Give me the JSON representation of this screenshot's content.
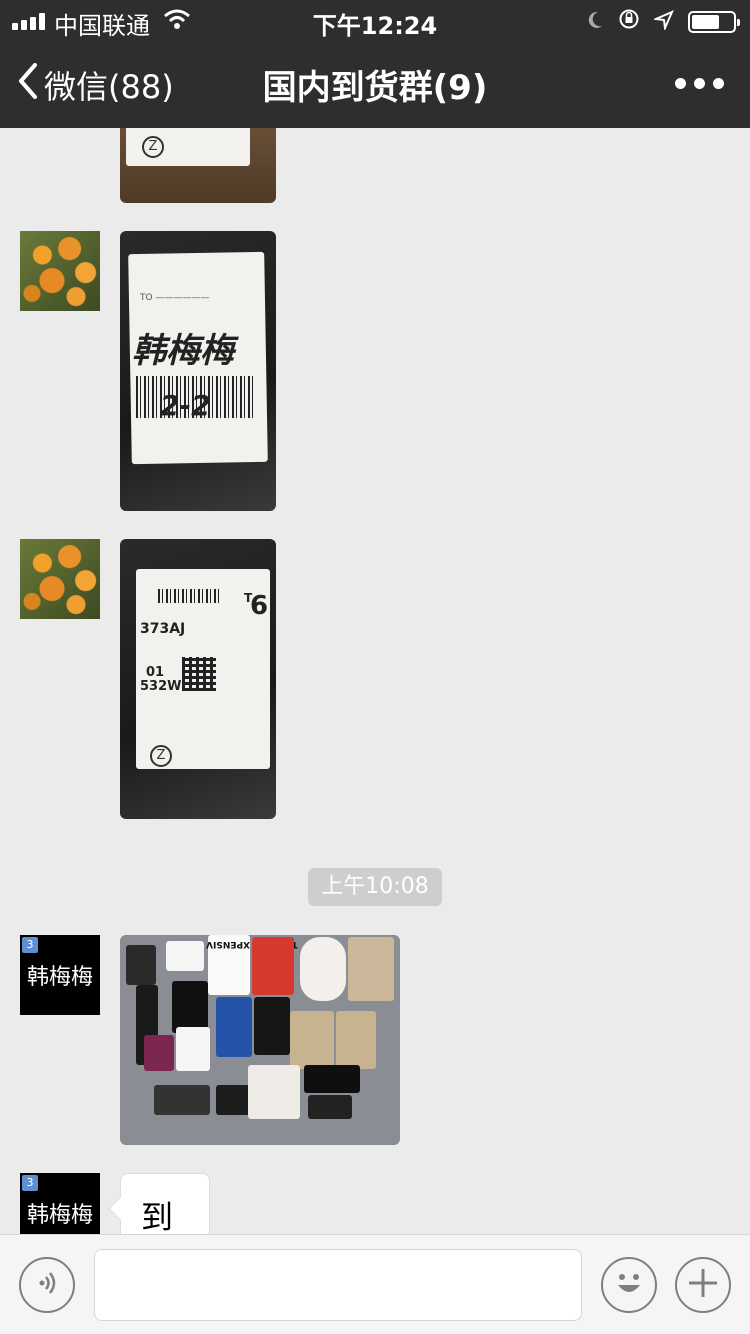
{
  "status_bar": {
    "carrier": "中国联通",
    "time": "下午12:24",
    "icons": [
      "signal-icon",
      "wifi-icon",
      "moon-icon",
      "rotation-lock-icon",
      "location-icon",
      "battery-icon"
    ]
  },
  "nav": {
    "back_label": "微信(88)",
    "title": "国内到货群(9)"
  },
  "messages": {
    "timestamp": "上午10:08",
    "avatar_name_1": "韩梅梅",
    "avatar_badge_1": "3",
    "avatar_name_2": "韩梅梅",
    "avatar_badge_2": "3",
    "text_message": "到"
  },
  "photo_labels": {
    "pkg2_handwriting": "韩梅梅",
    "pkg2_note": "2-2",
    "pkg3_code": "373AJ",
    "pkg3_num": "6",
    "pkg3_t": "T",
    "pkg3_row1": "01",
    "pkg3_row2": "532W",
    "zlogo": "Z",
    "clothes_text": "T'S VERY XPENSIV"
  },
  "colors": {
    "nav_bg": "#2e2e31",
    "chat_bg": "#ebebeb",
    "bubble_bg": "#ffffff"
  }
}
